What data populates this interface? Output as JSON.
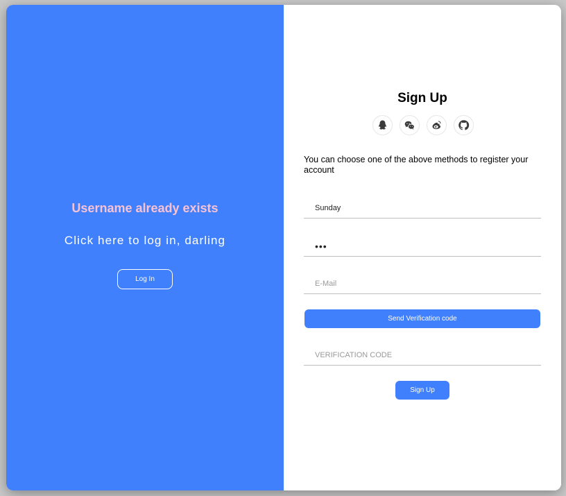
{
  "colors": {
    "accent": "#4080fc",
    "warning_text": "#f7c1d6",
    "panel_background": "#ffffff"
  },
  "left_panel": {
    "message": "Username already exists",
    "hint": "Click here to log in, darling",
    "login_button": "Log In"
  },
  "signup": {
    "title": "Sign Up",
    "social_icons": [
      "qq-icon",
      "wechat-icon",
      "weibo-icon",
      "github-icon"
    ],
    "description": "You can choose one of the above methods to register your account",
    "username_value": "Sunday",
    "password_value": "•••",
    "email_placeholder": "E-Mail",
    "send_code_button": "Send Verification code",
    "code_placeholder": "VERIFICATION CODE",
    "submit_button": "Sign Up"
  }
}
